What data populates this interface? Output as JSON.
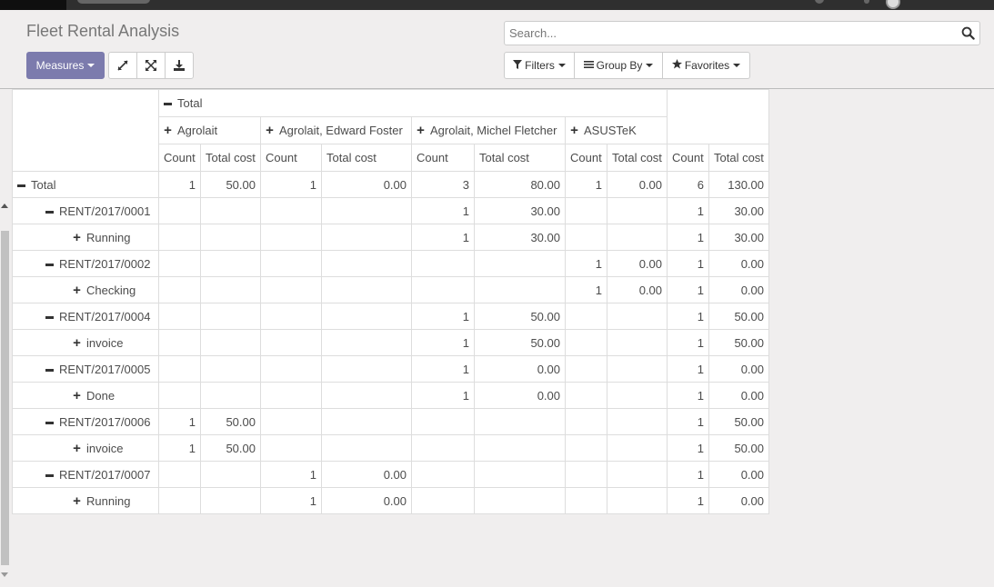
{
  "header": {
    "title": "Fleet Rental Analysis",
    "search_placeholder": "Search..."
  },
  "toolbar": {
    "measures_label": "Measures",
    "expand_icon": "expand-icon",
    "fullscreen_icon": "fullscreen-icon",
    "download_icon": "download-icon",
    "filters_label": "Filters",
    "groupby_label": "Group By",
    "favorites_label": "Favorites"
  },
  "pivot": {
    "col_total_label": "Total",
    "col_groups": [
      "Agrolait",
      "Agrolait, Edward Foster",
      "Agrolait, Michel Fletcher",
      "ASUSTeK"
    ],
    "measures": [
      "Count",
      "Total cost"
    ],
    "rows": [
      {
        "label": "Total",
        "level": 0,
        "toggle": "minus",
        "cells": [
          "1",
          "50.00",
          "1",
          "0.00",
          "3",
          "80.00",
          "1",
          "0.00"
        ],
        "total": [
          "6",
          "130.00"
        ],
        "bold": true
      },
      {
        "label": "RENT/2017/0001",
        "level": 1,
        "toggle": "minus",
        "cells": [
          "",
          "",
          "",
          "",
          "1",
          "30.00",
          "",
          ""
        ],
        "total": [
          "1",
          "30.00"
        ]
      },
      {
        "label": "Running",
        "level": 2,
        "toggle": "plus",
        "cells": [
          "",
          "",
          "",
          "",
          "1",
          "30.00",
          "",
          ""
        ],
        "total": [
          "1",
          "30.00"
        ]
      },
      {
        "label": "RENT/2017/0002",
        "level": 1,
        "toggle": "minus",
        "cells": [
          "",
          "",
          "",
          "",
          "",
          "",
          "1",
          "0.00"
        ],
        "total": [
          "1",
          "0.00"
        ]
      },
      {
        "label": "Checking",
        "level": 2,
        "toggle": "plus",
        "cells": [
          "",
          "",
          "",
          "",
          "",
          "",
          "1",
          "0.00"
        ],
        "total": [
          "1",
          "0.00"
        ]
      },
      {
        "label": "RENT/2017/0004",
        "level": 1,
        "toggle": "minus",
        "cells": [
          "",
          "",
          "",
          "",
          "1",
          "50.00",
          "",
          ""
        ],
        "total": [
          "1",
          "50.00"
        ]
      },
      {
        "label": "invoice",
        "level": 2,
        "toggle": "plus",
        "cells": [
          "",
          "",
          "",
          "",
          "1",
          "50.00",
          "",
          ""
        ],
        "total": [
          "1",
          "50.00"
        ]
      },
      {
        "label": "RENT/2017/0005",
        "level": 1,
        "toggle": "minus",
        "cells": [
          "",
          "",
          "",
          "",
          "1",
          "0.00",
          "",
          ""
        ],
        "total": [
          "1",
          "0.00"
        ]
      },
      {
        "label": "Done",
        "level": 2,
        "toggle": "plus",
        "cells": [
          "",
          "",
          "",
          "",
          "1",
          "0.00",
          "",
          ""
        ],
        "total": [
          "1",
          "0.00"
        ]
      },
      {
        "label": "RENT/2017/0006",
        "level": 1,
        "toggle": "minus",
        "cells": [
          "1",
          "50.00",
          "",
          "",
          "",
          "",
          "",
          ""
        ],
        "total": [
          "1",
          "50.00"
        ]
      },
      {
        "label": "invoice",
        "level": 2,
        "toggle": "plus",
        "cells": [
          "1",
          "50.00",
          "",
          "",
          "",
          "",
          "",
          ""
        ],
        "total": [
          "1",
          "50.00"
        ]
      },
      {
        "label": "RENT/2017/0007",
        "level": 1,
        "toggle": "minus",
        "cells": [
          "",
          "",
          "1",
          "0.00",
          "",
          "",
          "",
          ""
        ],
        "total": [
          "1",
          "0.00"
        ]
      },
      {
        "label": "Running",
        "level": 2,
        "toggle": "plus",
        "cells": [
          "",
          "",
          "1",
          "0.00",
          "",
          "",
          "",
          ""
        ],
        "total": [
          "1",
          "0.00"
        ]
      }
    ]
  },
  "colors": {
    "primary": "#7c7bad",
    "background": "#f0eeee",
    "topbar": "#2f2f2f"
  }
}
